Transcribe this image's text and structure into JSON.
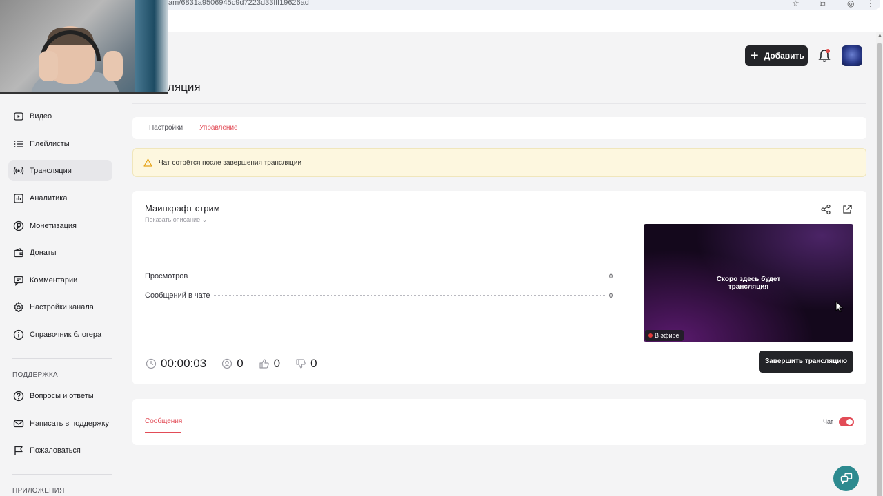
{
  "browser": {
    "url": "am/6831a9506945c9d7223d33fff19626ad"
  },
  "header": {
    "page_title": "ляция",
    "add_label": "Добавить"
  },
  "sidebar": {
    "items": [
      {
        "label": "Видео",
        "icon": "video-icon"
      },
      {
        "label": "Плейлисты",
        "icon": "playlist-icon"
      },
      {
        "label": "Трансляции",
        "icon": "broadcast-icon",
        "active": true
      },
      {
        "label": "Аналитика",
        "icon": "analytics-icon"
      },
      {
        "label": "Монетизация",
        "icon": "ruble-icon"
      },
      {
        "label": "Донаты",
        "icon": "wallet-icon"
      },
      {
        "label": "Комментарии",
        "icon": "comment-icon"
      },
      {
        "label": "Настройки канала",
        "icon": "gear-icon"
      },
      {
        "label": "Справочник блогера",
        "icon": "info-icon"
      }
    ],
    "support_heading": "ПОДДЕРЖКА",
    "support_items": [
      {
        "label": "Вопросы и ответы",
        "icon": "question-icon"
      },
      {
        "label": "Написать в поддержку",
        "icon": "mail-icon"
      },
      {
        "label": "Пожаловаться",
        "icon": "flag-icon"
      }
    ],
    "apps_heading": "ПРИЛОЖЕНИЯ"
  },
  "tabs": {
    "settings": "Настройки",
    "manage": "Управление",
    "active": "manage"
  },
  "warning": {
    "text": "Чат сотрётся после завершения трансляции"
  },
  "stream": {
    "title": "Маинкрафт стрим",
    "show_description": "Показать описание",
    "stats": [
      {
        "label": "Просмотров",
        "value": "0"
      },
      {
        "label": "Сообщений в чате",
        "value": "0"
      }
    ],
    "preview_line1": "Скоро здесь будет",
    "preview_line2": "трансляция",
    "live_label": "В эфире",
    "timer": "00:00:03",
    "viewers": "0",
    "likes": "0",
    "dislikes": "0",
    "end_label": "Завершить трансляцию"
  },
  "messages": {
    "tab_label": "Сообщения",
    "chat_label": "Чат",
    "chat_enabled": true
  },
  "colors": {
    "accent": "#e24c57",
    "dark_button": "#232428",
    "warning_bg": "#fdf7df",
    "fab": "#2d8a8f"
  }
}
